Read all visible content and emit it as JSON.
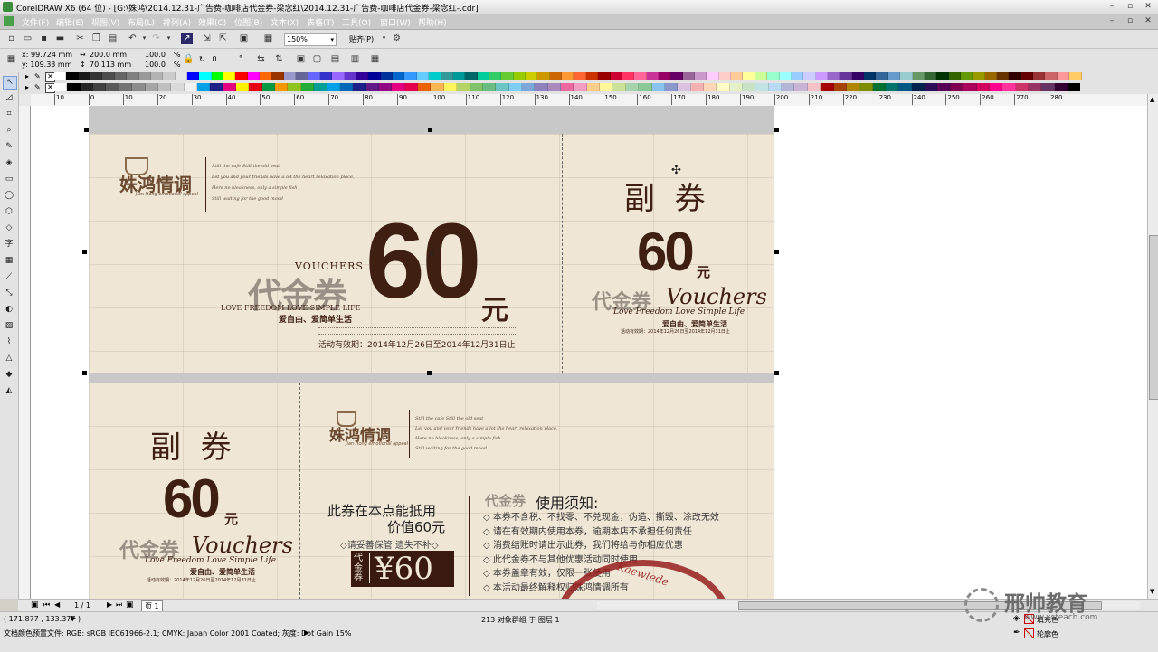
{
  "window": {
    "title": "CorelDRAW X6 (64 位) - [G:\\姝鸿\\2014.12.31-广告费-咖啡店代金券-梁念红\\2014.12.31-广告费-咖啡店代金券-梁念红-.cdr]"
  },
  "menu": [
    "文件(F)",
    "编辑(E)",
    "视图(V)",
    "布局(L)",
    "排列(A)",
    "效果(C)",
    "位图(B)",
    "文本(X)",
    "表格(T)",
    "工具(O)",
    "窗口(W)",
    "帮助(H)"
  ],
  "toolbar": {
    "zoom": "150%",
    "snap_label": "贴齐(P)"
  },
  "propbar": {
    "x": "x: 99.724 mm",
    "y": "y: 109.33 mm",
    "w": "200.0 mm",
    "h": "70.113 mm",
    "scale_x": "100.0",
    "scale_y": "100.0",
    "pct": "%",
    "angle": ".0",
    "deg": "°"
  },
  "ruler_ticks": [
    "10",
    "0",
    "10",
    "20",
    "30",
    "40",
    "50",
    "60",
    "70",
    "80",
    "90",
    "100",
    "110",
    "120",
    "130",
    "140",
    "150",
    "160",
    "170",
    "180",
    "190",
    "200",
    "210",
    "220",
    "230",
    "240",
    "250",
    "260",
    "270",
    "280"
  ],
  "palette": {
    "row1": [
      "#ffffff",
      "#000000",
      "#1a1a1a",
      "#333333",
      "#4d4d4d",
      "#666666",
      "#808080",
      "#999999",
      "#b3b3b3",
      "#cccccc",
      "#e6e6e6",
      "#0000ff",
      "#00ffff",
      "#00ff00",
      "#ffff00",
      "#ff0000",
      "#ff00ff",
      "#ff6600",
      "#993300",
      "#9999cc",
      "#666699",
      "#6666ff",
      "#3333cc",
      "#9966ff",
      "#6633cc",
      "#330099",
      "#000099",
      "#003399",
      "#0066cc",
      "#3399ff",
      "#66ccff",
      "#00cccc",
      "#339999",
      "#009999",
      "#006666",
      "#00cc99",
      "#33cc66",
      "#66cc33",
      "#99cc00",
      "#cccc00",
      "#cc9900",
      "#cc6600",
      "#ff9933",
      "#ff6633",
      "#cc3300",
      "#990000",
      "#cc0033",
      "#ff3366",
      "#ff6699",
      "#cc3399",
      "#990066",
      "#660066",
      "#996699",
      "#cc99cc",
      "#ffccff",
      "#ffcccc",
      "#ffcc99",
      "#ffff99",
      "#ccff99",
      "#99ffcc",
      "#99ffff",
      "#99ccff",
      "#ccccff",
      "#cc99ff",
      "#9966cc",
      "#663399",
      "#330066",
      "#003366",
      "#336699",
      "#6699cc",
      "#99cccc",
      "#669966",
      "#336633",
      "#003300",
      "#336600",
      "#669900",
      "#999900",
      "#996600",
      "#663300",
      "#330000",
      "#660000",
      "#993333",
      "#cc6666",
      "#ff9999",
      "#ffcc66"
    ],
    "row2": [
      "#ffffff",
      "#000000",
      "#262626",
      "#404040",
      "#595959",
      "#737373",
      "#8c8c8c",
      "#a6a6a6",
      "#bfbfbf",
      "#d9d9d9",
      "#f2f2f2",
      "#00a0e9",
      "#1d2088",
      "#e4007f",
      "#fff100",
      "#e60012",
      "#009944",
      "#f39800",
      "#8fc31f",
      "#22ac38",
      "#009e96",
      "#00a0e9",
      "#0068b7",
      "#1d2088",
      "#601986",
      "#920783",
      "#e4007f",
      "#e5004f",
      "#eb6100",
      "#f8b551",
      "#fff45c",
      "#b3d465",
      "#80c269",
      "#69bd83",
      "#6cc5c6",
      "#7ecef4",
      "#7da7d9",
      "#8f82bc",
      "#aa89bd",
      "#ec6aa0",
      "#f19ec2",
      "#facd89",
      "#fff799",
      "#cce198",
      "#a5d4ad",
      "#89c997",
      "#89c3eb",
      "#8c97cb",
      "#d9c3e1",
      "#f5b2b2",
      "#fbd7b5",
      "#fffbc7",
      "#e4f0c6",
      "#c7e2c5",
      "#c1e3e4",
      "#b9daf4",
      "#b5b5d8",
      "#c9b4d5",
      "#f6c1c7",
      "#a40000",
      "#a84200",
      "#b28500",
      "#7c8e00",
      "#007130",
      "#00736d",
      "#005982",
      "#00204e",
      "#2b0d57",
      "#580058",
      "#7f004f",
      "#ac005d",
      "#d3005d",
      "#ff0090",
      "#ff3399",
      "#cc3366",
      "#993366",
      "#663366",
      "#330033",
      "#000000"
    ]
  },
  "canvas": {
    "v1": {
      "logo": "姝鸿情调",
      "logo_sub": "Jian Hong emotional appeal",
      "poem": [
        "Still the cafe Still the old seat",
        "Let you and your friends have a lot the heart relaxation place,",
        "Here no bleakness, only a simple fish",
        "Still waiting for the good mood"
      ],
      "vouchers_word": "VOUCHERS",
      "big_amount": "60",
      "yuan": "元",
      "daijinquan": "代金券",
      "love_en": "LOVE FREEDOM   LOVE SIMPLE LIFE",
      "love_cn": "爱自由、爱简单生活",
      "validity": "活动有效期：2014年12月26日至2014年12月31日止",
      "stub_title": "副  券",
      "stub_amount": "60",
      "stub_yuan": "元",
      "stub_script": "Vouchers",
      "stub_script2": "Love Freedom  Love Simple Life",
      "stub_love_cn": "爱自由、爱简单生活",
      "stub_validity": "活动有效期：2014年12月26日至2014年12月31日止"
    },
    "v2": {
      "stub_title": "副  券",
      "stub_amount": "60",
      "stub_yuan": "元",
      "stub_daijin": "代金券",
      "stub_script": "Vouchers",
      "stub_script2": "Love Freedom  Love Simple Life",
      "stub_love_cn": "爱自由、爱简单生活",
      "stub_validity": "活动有效期：2014年12月26日至2014年12月31日止",
      "logo": "姝鸿情调",
      "logo_sub": "Jian Hong emotional appeal",
      "poem": [
        "Still the cafe Still the old seat",
        "Let you and your friends have a lot the heart relaxation place,",
        "Here no bleakness, only a simple fish",
        "Still waiting for the good mood"
      ],
      "line1": "此券在本点能抵用",
      "line2": "价值60元",
      "keep": "◇请妥善保管  遗失不补◇",
      "price_badge_left": "代金券",
      "price_badge": "¥60",
      "notice_tag": "代金券",
      "notice_title": "使用须知:",
      "notices": [
        "本券不含税、不找零、不兑现金，伪造、撕毁、涂改无效",
        "请在有效期内使用本券，逾期本店不承担任何责任",
        "消费结账时请出示此券，我们将给与你相应优惠",
        "此代金券不与其他优惠活动同时使用",
        "本券盖章有效，仅限一张使用",
        "本活动最终解释权归姝鸿情调所有"
      ],
      "stamp_text": "Kaewlede"
    }
  },
  "pager": {
    "count": "1 / 1",
    "page_tab": "页 1"
  },
  "status": {
    "coords": "( 171.877 , 133.377 )",
    "objects": "213 对象群组 于 图层 1",
    "color_profile": "文档颜色预置文件: RGB: sRGB IEC61966-2.1; CMYK: Japan Color 2001 Coated; 灰度: Dot Gain 15%",
    "fill_label": "填充色",
    "outline_label": "轮廓色"
  },
  "watermark": {
    "brand": "邢帅教育",
    "url": "www.xsteach.com"
  }
}
